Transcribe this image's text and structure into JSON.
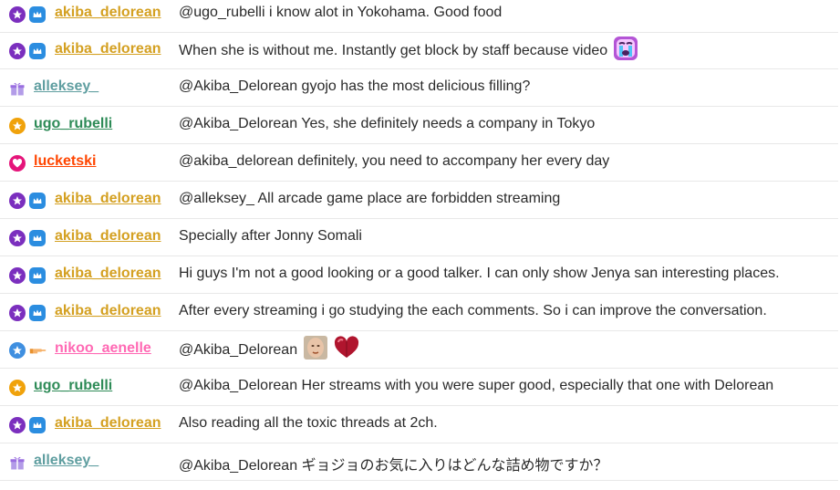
{
  "colors": {
    "akiba": "#d4a021",
    "alleksey": "#5f9ea0",
    "ugo": "#2e8b57",
    "lucketski": "#ff4500",
    "nikoo": "#ff69b4",
    "star_purple": "#7b2fbe",
    "crown_blue": "#2b8de0",
    "star_orange": "#f0a20b",
    "star_blue": "#3f8fe0",
    "heart_pink": "#e5157a",
    "gift_purple": "#9a6ee0"
  },
  "messages": [
    {
      "user": "akiba_delorean",
      "text": "@ugo_rubelli i know alot in Yokohama. Good food"
    },
    {
      "user": "akiba_delorean",
      "text": "When she is without me. Instantly get block by staff because video",
      "emote": "crying-emote"
    },
    {
      "user": "alleksey_",
      "text": "@Akiba_Delorean gyojo has the most delicious filling?"
    },
    {
      "user": "ugo_rubelli",
      "text": "@Akiba_Delorean Yes, she definitely needs a company in Tokyo"
    },
    {
      "user": "lucketski",
      "text": "@akiba_delorean definitely, you need to accompany her every day"
    },
    {
      "user": "akiba_delorean",
      "text": "@alleksey_ All arcade game place are forbidden streaming"
    },
    {
      "user": "akiba_delorean",
      "text": "Specially after Jonny Somali"
    },
    {
      "user": "akiba_delorean",
      "text": "Hi guys I'm not a good looking or a good talker. I can only show Jenya san interesting places."
    },
    {
      "user": "akiba_delorean",
      "text": "After every streaming i go studying the each comments. So i can improve the conversation."
    },
    {
      "user": "nikoo_aenelle",
      "text": "@Akiba_Delorean",
      "emote": "face-emote",
      "emote2": "heart-emote"
    },
    {
      "user": "ugo_rubelli",
      "text": "@Akiba_Delorean Her streams with you were super good, especially that one with Delorean"
    },
    {
      "user": "akiba_delorean",
      "text": "Also reading all the toxic threads at 2ch."
    },
    {
      "user": "alleksey_",
      "text": "@Akiba_Delorean ギョジョのお気に入りはどんな詰め物ですか？"
    }
  ]
}
